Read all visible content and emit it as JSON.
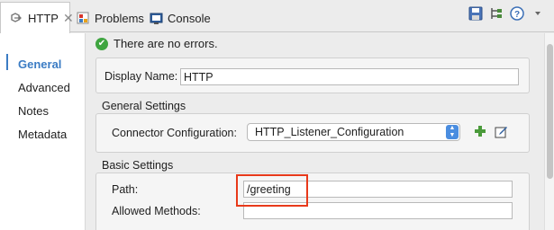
{
  "tabs": {
    "http": "HTTP",
    "problems": "Problems",
    "console": "Console"
  },
  "nav": {
    "items": [
      "General",
      "Advanced",
      "Notes",
      "Metadata"
    ],
    "selected": "General"
  },
  "status": {
    "message": "There are no errors."
  },
  "general": {
    "display_name_label": "Display Name:",
    "display_name_value": "HTTP"
  },
  "general_settings": {
    "title": "General Settings",
    "connector_label": "Connector Configuration:",
    "connector_value": "HTTP_Listener_Configuration"
  },
  "basic_settings": {
    "title": "Basic Settings",
    "path_label": "Path:",
    "path_value": "/greeting",
    "methods_label": "Allowed Methods:",
    "methods_value": ""
  },
  "colors": {
    "accent": "#3b7cc4",
    "highlight": "#e8391a",
    "success": "#3fa540"
  }
}
